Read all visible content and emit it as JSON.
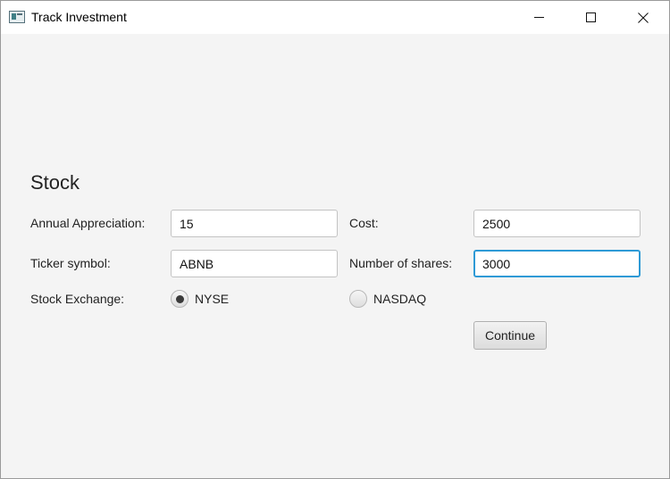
{
  "window": {
    "title": "Track Investment",
    "icon": "java-app-icon"
  },
  "form": {
    "heading": "Stock",
    "annual_appreciation": {
      "label": "Annual Appreciation:",
      "value": "15"
    },
    "cost": {
      "label": "Cost:",
      "value": "2500"
    },
    "ticker_symbol": {
      "label": "Ticker symbol:",
      "value": "ABNB"
    },
    "number_of_shares": {
      "label": "Number of shares:",
      "value": "3000"
    },
    "stock_exchange": {
      "label": "Stock Exchange:",
      "options": [
        {
          "label": "NYSE",
          "selected": true
        },
        {
          "label": "NASDAQ",
          "selected": false
        }
      ]
    },
    "continue_label": "Continue"
  },
  "colors": {
    "focus_border": "#2e9ad6",
    "background": "#f4f4f4"
  }
}
